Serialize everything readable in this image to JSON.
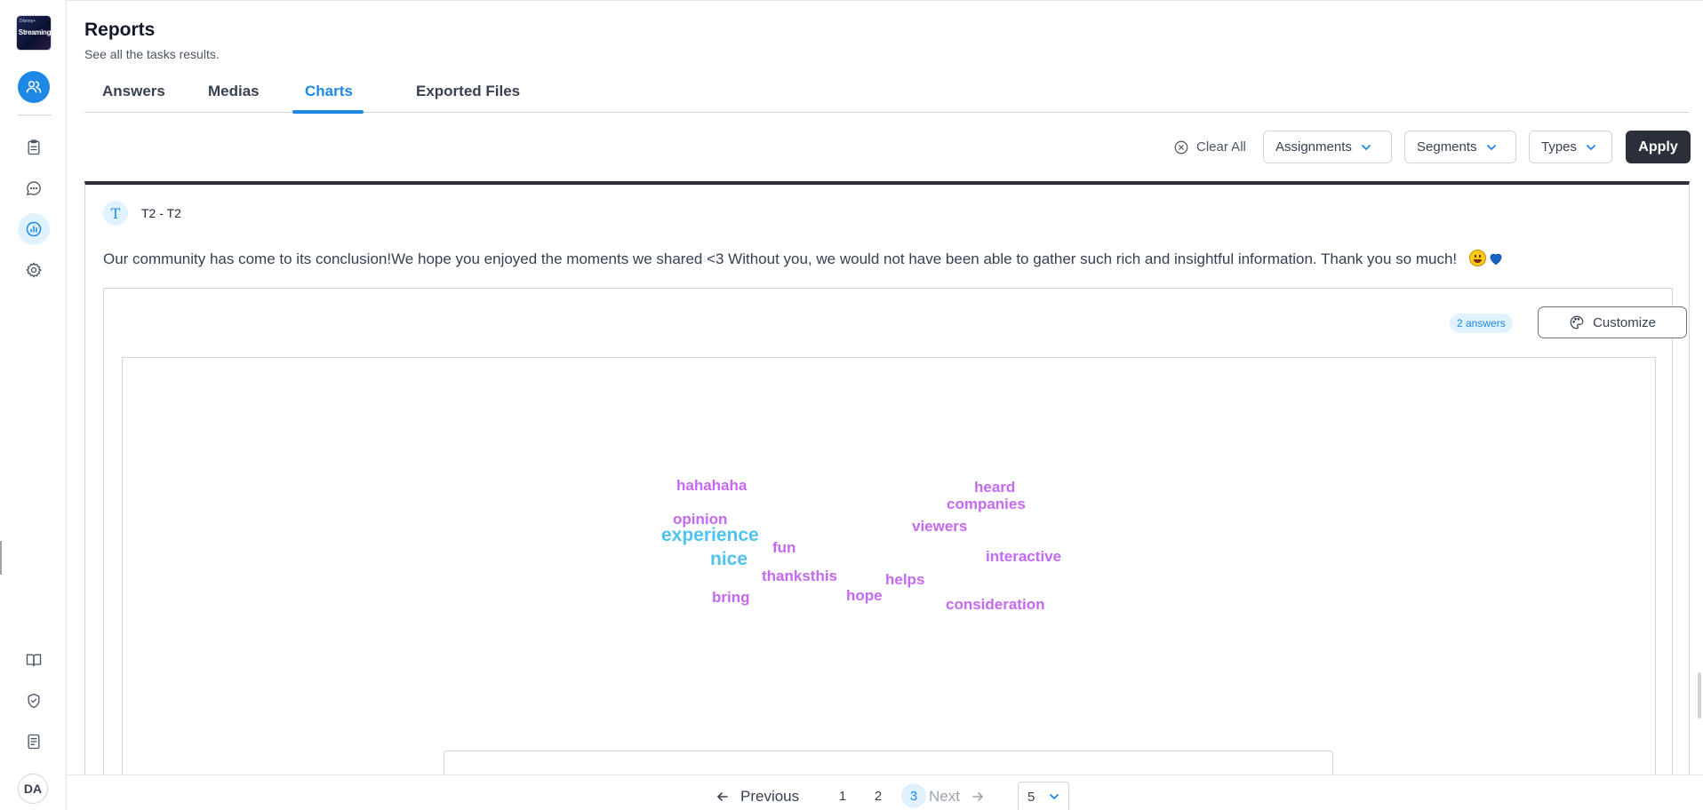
{
  "sidebar": {
    "logo_text": "Streaming",
    "logo_small": "Disney+",
    "avatar_initials": "DA",
    "items": [
      {
        "name": "users-icon"
      },
      {
        "name": "clipboard-icon"
      },
      {
        "name": "chat-icon"
      },
      {
        "name": "reports-icon"
      },
      {
        "name": "gear-icon"
      },
      {
        "name": "book-icon"
      },
      {
        "name": "shield-check-icon"
      },
      {
        "name": "document-icon"
      }
    ]
  },
  "header": {
    "title": "Reports",
    "subtitle": "See all the tasks results."
  },
  "tabs": [
    {
      "label": "Answers"
    },
    {
      "label": "Medias"
    },
    {
      "label": "Charts",
      "active": true
    },
    {
      "label": "Exported Files"
    }
  ],
  "filters": {
    "clear_all": "Clear All",
    "assignments": "Assignments",
    "segments": "Segments",
    "types": "Types",
    "apply": "Apply"
  },
  "task": {
    "badge": "T",
    "label": "T2 - T2",
    "description": "Our community has come to its conclusion!We hope you enjoyed the moments we shared <3 Without you, we would not have been able to gather such rich and insightful information.  Thank you so much!",
    "answers_count": "2 answers",
    "customize": "Customize"
  },
  "chart_data": {
    "type": "wordcloud",
    "colors": {
      "primary": "#c569f2",
      "highlight": "#4fc3ef"
    },
    "words": [
      {
        "text": "hahahaha",
        "weight": 1
      },
      {
        "text": "heard",
        "weight": 1
      },
      {
        "text": "companies",
        "weight": 1
      },
      {
        "text": "opinion",
        "weight": 1
      },
      {
        "text": "experience",
        "weight": 2
      },
      {
        "text": "viewers",
        "weight": 1
      },
      {
        "text": "fun",
        "weight": 1
      },
      {
        "text": "nice",
        "weight": 2
      },
      {
        "text": "interactive",
        "weight": 1
      },
      {
        "text": "thanksthis",
        "weight": 1
      },
      {
        "text": "helps",
        "weight": 1
      },
      {
        "text": "hope",
        "weight": 1
      },
      {
        "text": "bring",
        "weight": 1
      },
      {
        "text": "consideration",
        "weight": 1
      }
    ]
  },
  "pagination": {
    "previous": "Previous",
    "pages": [
      "1",
      "2",
      "3"
    ],
    "current": "3",
    "next": "Next",
    "page_size": "5"
  }
}
